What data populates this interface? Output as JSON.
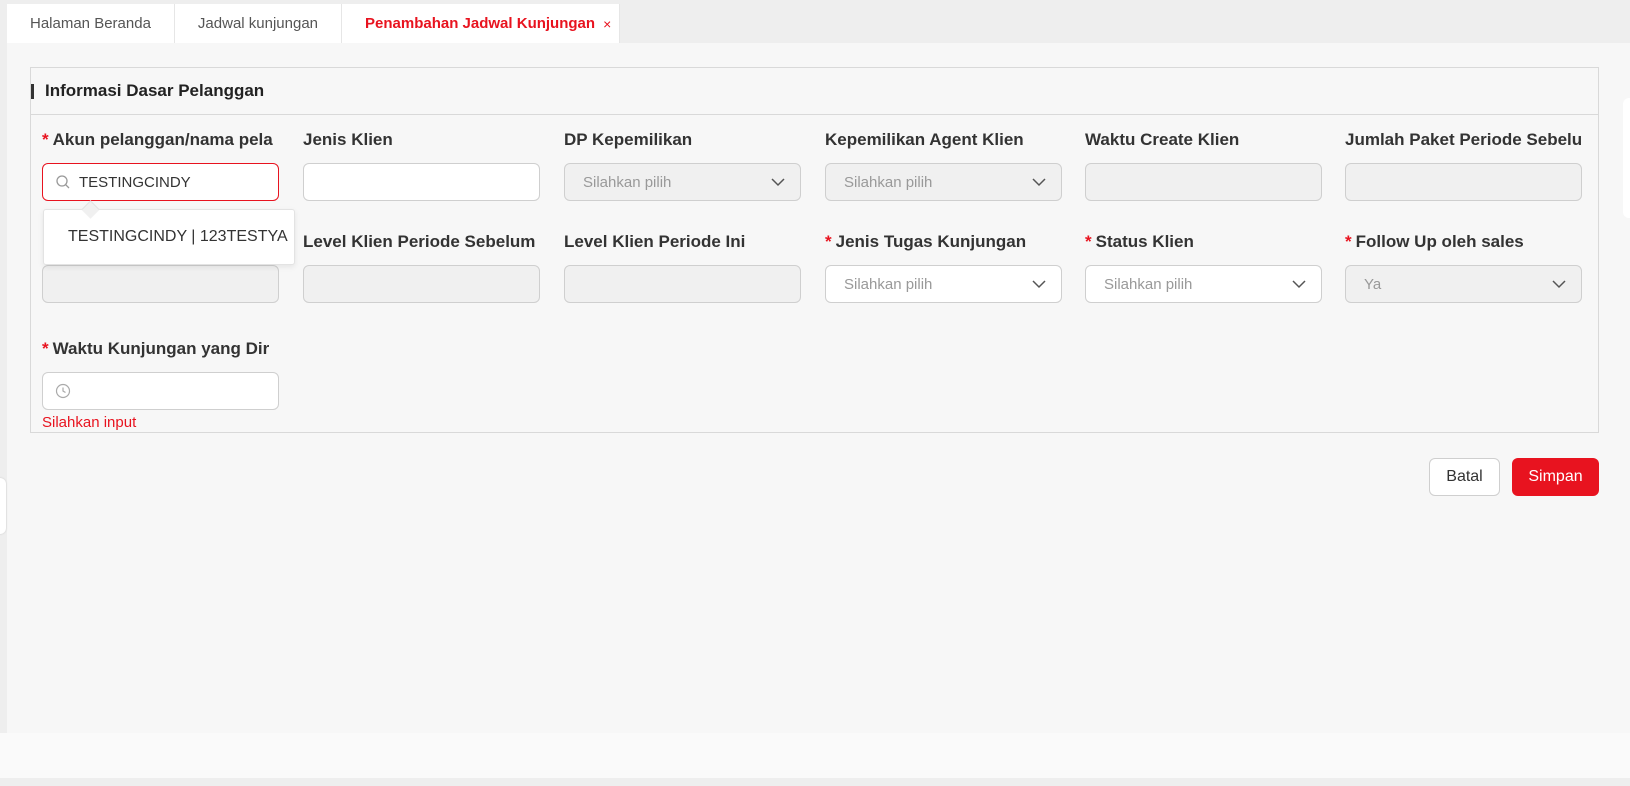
{
  "tabs": [
    {
      "label": "Halaman Beranda"
    },
    {
      "label": "Jadwal kunjungan"
    },
    {
      "label": "Penambahan Jadwal Kunjungan",
      "close": "×"
    }
  ],
  "section": {
    "title": "Informasi Dasar Pelanggan"
  },
  "fields": {
    "akun": {
      "label": "Akun pelanggan/nama pela",
      "value": "TESTINGCINDY"
    },
    "jenis_klien": {
      "label": "Jenis Klien"
    },
    "dp": {
      "label": "DP Kepemilikan",
      "placeholder": "Silahkan pilih"
    },
    "agent": {
      "label": "Kepemilikan Agent Klien",
      "placeholder": "Silahkan pilih"
    },
    "waktu_create": {
      "label": "Waktu Create Klien"
    },
    "jumlah_paket": {
      "label": "Jumlah Paket Periode Sebelu"
    },
    "level_sebelum": {
      "label": "Level Klien Periode Sebelum"
    },
    "level_ini": {
      "label": "Level Klien Periode Ini"
    },
    "jenis_tugas": {
      "label": "Jenis Tugas Kunjungan",
      "placeholder": "Silahkan pilih"
    },
    "status": {
      "label": "Status Klien",
      "placeholder": "Silahkan pilih"
    },
    "follow_up": {
      "label": "Follow Up oleh sales",
      "value": "Ya"
    },
    "waktu_kunjungan": {
      "label": "Waktu Kunjungan yang Dir",
      "error": "Silahkan input"
    }
  },
  "dropdown": {
    "option": "TESTINGCINDY | 123TESTYA"
  },
  "buttons": {
    "cancel": "Batal",
    "save": "Simpan"
  },
  "colors": {
    "accent": "#e8131f"
  }
}
